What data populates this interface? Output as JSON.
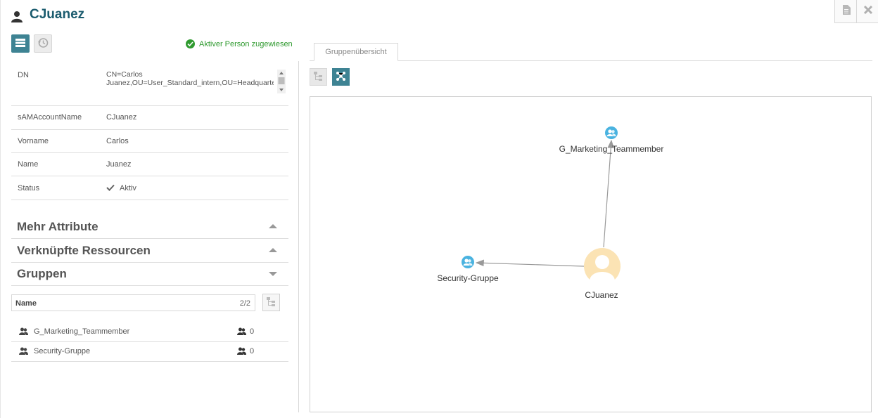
{
  "header": {
    "title": "CJuanez",
    "status_message": "Aktiver Person zugewiesen"
  },
  "tabs": {
    "group_overview": "Gruppenübersicht"
  },
  "attributes": [
    {
      "label": "DN",
      "value": "CN=Carlos Juanez,OU=User_Standard_intern,OU=Headquarter,OU=Organisation,DC=daccord,DC=de"
    },
    {
      "label": "sAMAccountName",
      "value": "CJuanez"
    },
    {
      "label": "Vorname",
      "value": "Carlos"
    },
    {
      "label": "Name",
      "value": "Juanez"
    },
    {
      "label": "Status",
      "value": "Aktiv"
    }
  ],
  "sections": {
    "more_attributes": "Mehr Attribute",
    "linked_resources": "Verknüpfte Ressourcen",
    "groups": "Gruppen"
  },
  "groups_table": {
    "column_name": "Name",
    "count": "2/2",
    "rows": [
      {
        "name": "G_Marketing_Teammember",
        "members": "0"
      },
      {
        "name": "Security-Gruppe",
        "members": "0"
      }
    ]
  },
  "graph": {
    "nodes": [
      {
        "label": "G_Marketing_Teammember",
        "kind": "group"
      },
      {
        "label": "Security-Gruppe",
        "kind": "group"
      },
      {
        "label": "CJuanez",
        "kind": "user"
      }
    ]
  },
  "colors": {
    "accent": "#3e8393",
    "title": "#1a5b6e",
    "success": "#2f9a2f",
    "group_node": "#4ab3e0",
    "user_node": "#fbe3b4"
  },
  "icons": {
    "title": "user-icon",
    "view_list": "list-icon",
    "view_history": "history-icon",
    "status": "check-icon",
    "group": "group-icon",
    "tree": "tree-icon",
    "network": "network-icon",
    "document": "document-icon",
    "close": "close-icon"
  }
}
